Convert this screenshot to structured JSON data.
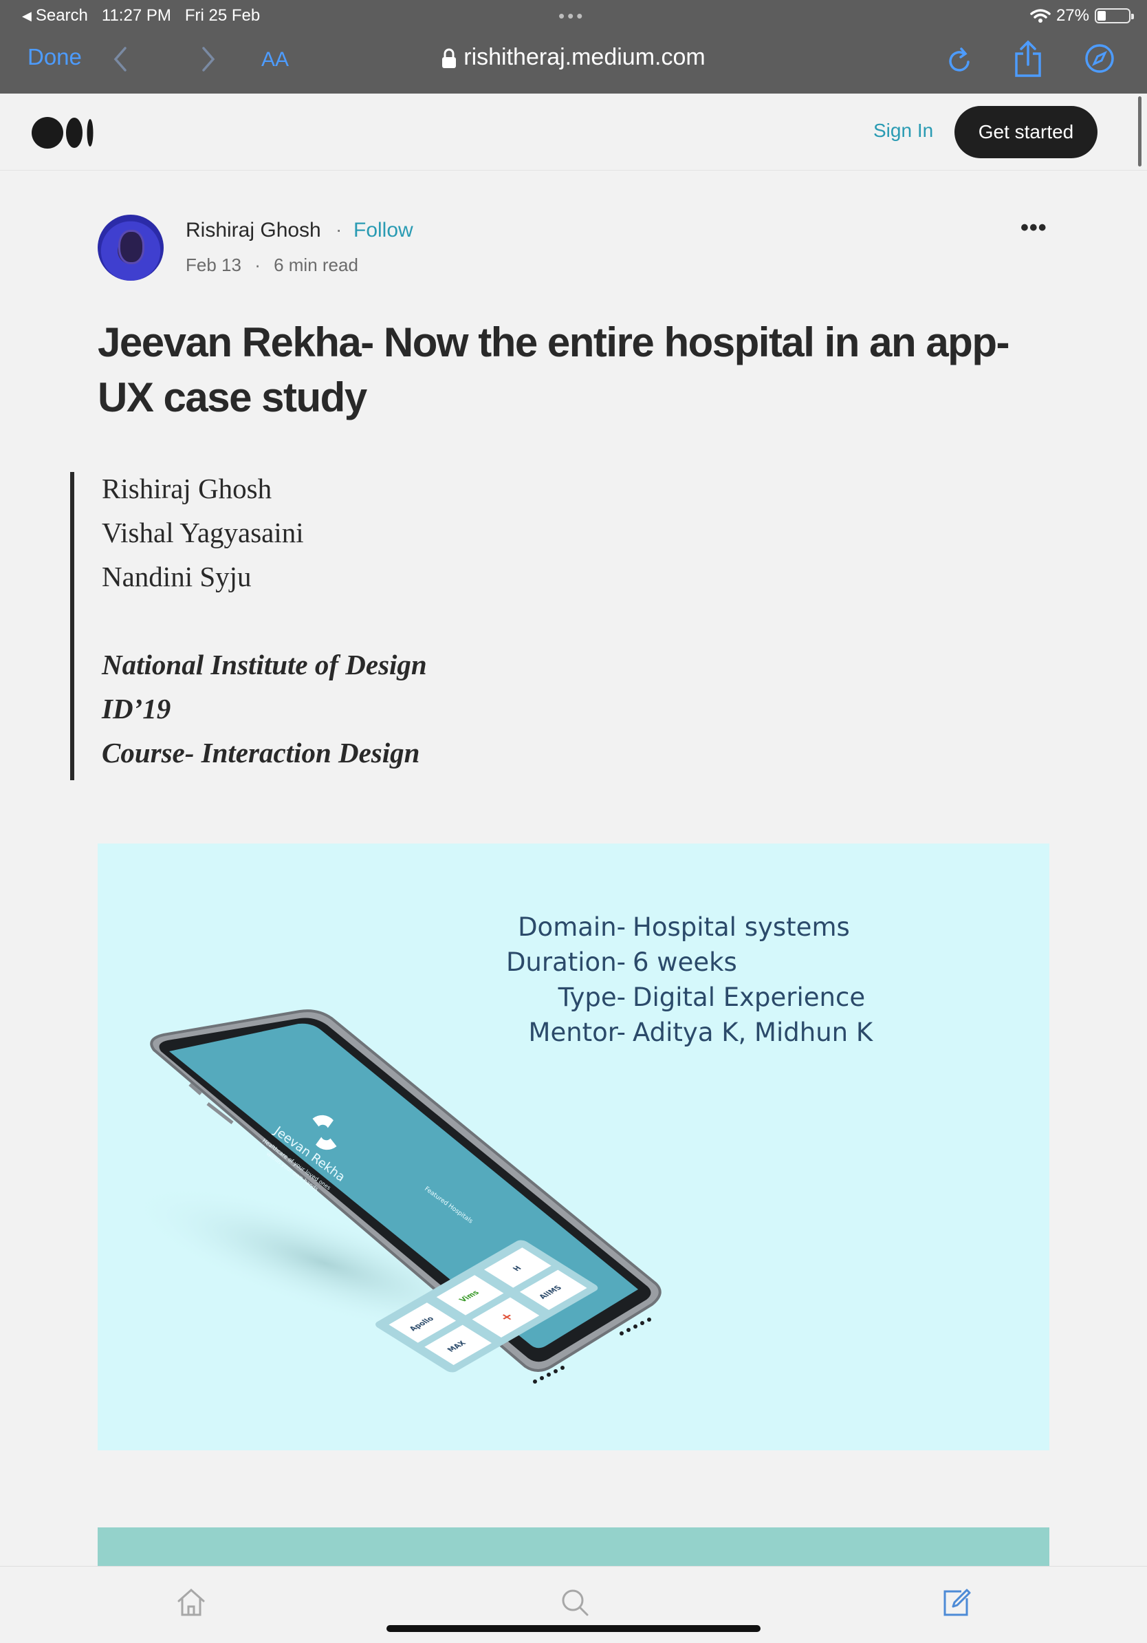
{
  "status_bar": {
    "back_label": "Search",
    "time": "11:27 PM",
    "date": "Fri 25 Feb",
    "battery_pct_text": "27%",
    "battery_level": 0.27
  },
  "browser": {
    "done_label": "Done",
    "text_size_label": "AA",
    "url": "rishitheraj.medium.com",
    "accent_color": "#4d9cff"
  },
  "site_header": {
    "sign_in_label": "Sign In",
    "get_started_label": "Get started"
  },
  "article": {
    "author": "Rishiraj Ghosh",
    "follow_label": "Follow",
    "date": "Feb 13",
    "read_time": "6 min read",
    "title": "Jeevan Rekha- Now the entire hospital in an app-UX case study",
    "quote": {
      "people": [
        "Rishiraj Ghosh",
        "Vishal Yagyasaini",
        "Nandini Syju"
      ],
      "institution": [
        "National Institute of Design",
        "ID’19",
        "Course- Interaction Design"
      ]
    },
    "hero": {
      "details": [
        {
          "key": "Domain-",
          "value": "Hospital systems"
        },
        {
          "key": "Duration-",
          "value": "6 weeks"
        },
        {
          "key": "Type-",
          "value": "Digital Experience"
        },
        {
          "key": "Mentor-",
          "value": "Aditya K, Midhun K"
        }
      ],
      "app_name": "Jeevan Rekha",
      "app_tagline_1": "Healthcare of your loved ones",
      "app_tagline_2": "within your own hands",
      "featured_label": "Featured Hospitals",
      "hospital_logos": [
        "Apollo",
        "Vims",
        "H",
        "MAX",
        "+",
        "AIIMS"
      ]
    }
  },
  "colors": {
    "medium_link": "#2a9bb3",
    "hero_bg": "#d5f8fb",
    "app_screen": "#55aabd",
    "band": "#94d2cb"
  }
}
